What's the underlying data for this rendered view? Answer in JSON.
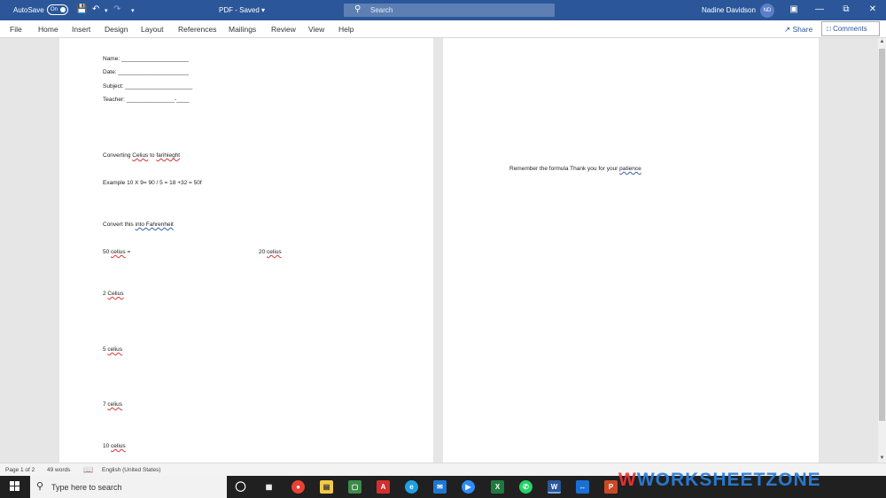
{
  "titlebar": {
    "autosave_label": "AutoSave",
    "autosave_state": "On",
    "document_title": "PDF - Saved",
    "search_placeholder": "Search",
    "user_name": "Nadine Davidson",
    "user_initials": "ND",
    "accent_color": "#2b579a"
  },
  "ribbon": {
    "tabs": [
      "File",
      "Home",
      "Insert",
      "Design",
      "Layout",
      "References",
      "Mailings",
      "Review",
      "View",
      "Help"
    ],
    "share_label": "Share",
    "comments_label": "Comments"
  },
  "page1": {
    "fields": {
      "name": "Name: _____________________",
      "date": "Date: ______________________",
      "subject": "Subject: _____________________",
      "teacher": "Teacher: _______________-____"
    },
    "title_parts": [
      "Converting ",
      "Celius",
      " to ",
      "farihieght"
    ],
    "example": "Example 10 X 9= 90 / 5 = 18 +32 = 50f",
    "instruction_parts": [
      "Convert this ",
      "into  Fahrenheit"
    ],
    "items": [
      {
        "num": "50 ",
        "unit": "celius",
        "suffix": " ="
      },
      {
        "num": "20 ",
        "unit": "celius",
        "suffix": ""
      },
      {
        "num": "2 ",
        "unit": "Celius",
        "suffix": ""
      },
      {
        "num": "5 ",
        "unit": "celius",
        "suffix": ""
      },
      {
        "num": "7 ",
        "unit": "celius",
        "suffix": ""
      },
      {
        "num": "10 ",
        "unit": "celius",
        "suffix": ""
      }
    ]
  },
  "page2": {
    "text_parts": [
      "Remember the formula Thank you for your ",
      "patience"
    ]
  },
  "statusbar": {
    "page": "Page 1 of 2",
    "words": "49 words",
    "language": "English (United States)"
  },
  "taskbar": {
    "search_placeholder": "Type here to search"
  },
  "watermark": {
    "w_letter": "W",
    "text": "WORKSHEETZONE"
  }
}
